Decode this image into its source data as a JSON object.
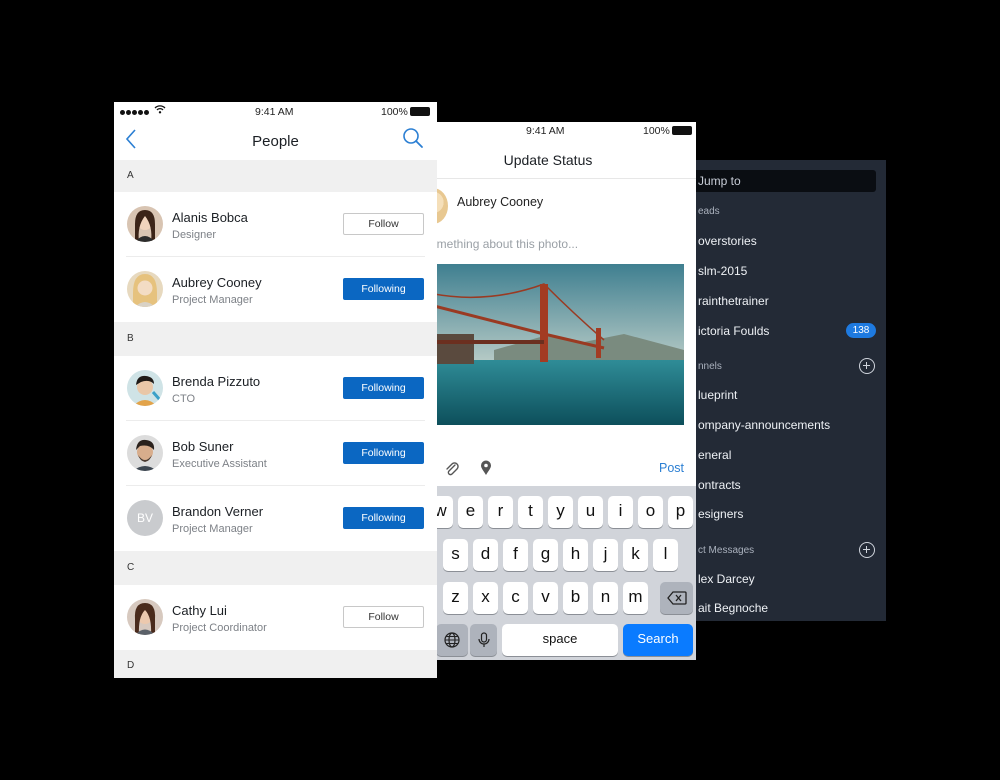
{
  "back_screen": {
    "jump_placeholder": "Jump to",
    "threads_section": "eads",
    "threads": [
      {
        "label": "overstories"
      },
      {
        "label": "slm-2015"
      },
      {
        "label": "rainthetrainer"
      },
      {
        "label": "ictoria Foulds",
        "badge": "138"
      }
    ],
    "channels_section": "nnels",
    "channels": [
      "lueprint",
      "ompany-announcements",
      "eneral",
      "ontracts",
      "esigners"
    ],
    "dm_section": "ct Messages",
    "dms": [
      "lex Darcey",
      "ait Begnoche"
    ]
  },
  "status_screen": {
    "time": "9:41 AM",
    "battery": "100%",
    "title": "Update Status",
    "user_name": "Aubrey Cooney",
    "placeholder": "omething about this photo...",
    "post_label": "Post",
    "keyboard": {
      "row1": [
        "w",
        "e",
        "r",
        "t",
        "y",
        "u",
        "i",
        "o",
        "p"
      ],
      "row2": [
        "s",
        "d",
        "f",
        "g",
        "h",
        "j",
        "k",
        "l"
      ],
      "row3": [
        "z",
        "x",
        "c",
        "v",
        "b",
        "n",
        "m"
      ],
      "space_label": "space",
      "search_label": "Search"
    }
  },
  "people_screen": {
    "time": "9:41 AM",
    "battery": "100%",
    "title": "People",
    "sections": [
      {
        "letter": "A",
        "people": [
          {
            "name": "Alanis Bobca",
            "role": "Designer",
            "button": "Follow",
            "following": false
          },
          {
            "name": "Aubrey Cooney",
            "role": "Project Manager",
            "button": "Following",
            "following": true
          }
        ]
      },
      {
        "letter": "B",
        "people": [
          {
            "name": "Brenda Pizzuto",
            "role": "CTO",
            "button": "Following",
            "following": true
          },
          {
            "name": "Bob Suner",
            "role": "Executive Assistant",
            "button": "Following",
            "following": true
          },
          {
            "name": "Brandon Verner",
            "role": "Project Manager",
            "button": "Following",
            "following": true,
            "initials": "BV"
          }
        ]
      },
      {
        "letter": "C",
        "people": [
          {
            "name": "Cathy Lui",
            "role": "Project Coordinator",
            "button": "Follow",
            "following": false
          }
        ]
      },
      {
        "letter": "D",
        "people": []
      }
    ]
  },
  "colors": {
    "accent": "#0b67c2",
    "dark_panel": "#232a36",
    "badge": "#1e7ae0",
    "search_key": "#0a7bff"
  }
}
